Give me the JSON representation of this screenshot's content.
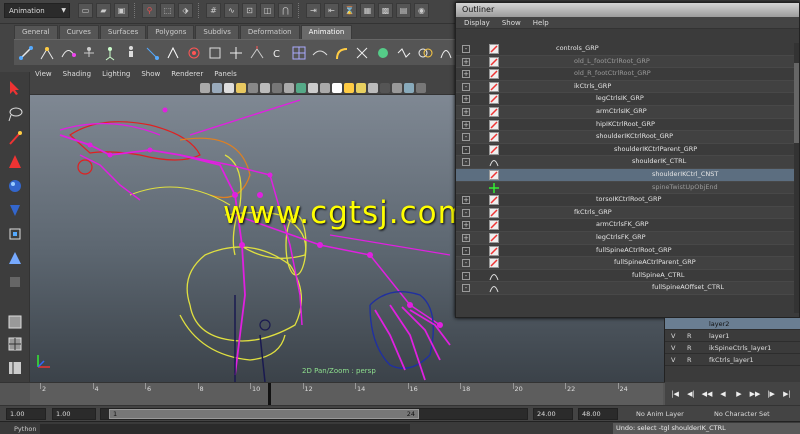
{
  "toolbar": {
    "mode": "Animation",
    "shelf_tabs": [
      "General",
      "Curves",
      "Surfaces",
      "Polygons",
      "Subdivs",
      "Deformation",
      "Animation"
    ],
    "active_tab": "Animation"
  },
  "viewport": {
    "menus": [
      "View",
      "Shading",
      "Lighting",
      "Show",
      "Renderer",
      "Panels"
    ],
    "status": "2D Pan/Zoom : persp",
    "watermark": "www.cgtsj.com"
  },
  "outliner": {
    "title": "Outliner",
    "menus": [
      "Display",
      "Show",
      "Help"
    ],
    "rows": [
      {
        "name": "controls_GRP",
        "depth": 0,
        "icon": "group-icon",
        "expand": "-"
      },
      {
        "name": "old_L_footCtrlRoot_GRP",
        "depth": 1,
        "icon": "group-icon",
        "expand": "+",
        "grey": true
      },
      {
        "name": "old_R_footCtrlRoot_GRP",
        "depth": 1,
        "icon": "group-icon",
        "expand": "+",
        "grey": true
      },
      {
        "name": "ikCtrls_GRP",
        "depth": 1,
        "icon": "group-icon",
        "expand": "-"
      },
      {
        "name": "legCtrlsIK_GRP",
        "depth": 2,
        "icon": "group-icon",
        "expand": "+"
      },
      {
        "name": "armCtrlsIK_GRP",
        "depth": 2,
        "icon": "group-icon",
        "expand": "+"
      },
      {
        "name": "hipIKCtrlRoot_GRP",
        "depth": 2,
        "icon": "group-icon",
        "expand": "+"
      },
      {
        "name": "shoulderIKCtrlRoot_GRP",
        "depth": 2,
        "icon": "group-icon",
        "expand": "-"
      },
      {
        "name": "shoulderIKCtrlParent_GRP",
        "depth": 3,
        "icon": "group-icon",
        "expand": "-"
      },
      {
        "name": "shoulderIK_CTRL",
        "depth": 4,
        "icon": "curve-icon",
        "expand": "-"
      },
      {
        "name": "shoulderIKCtrl_CNST",
        "depth": 5,
        "icon": "group-icon",
        "expand": "",
        "selected": true
      },
      {
        "name": "spineTwistUpObjEnd",
        "depth": 5,
        "icon": "locator-icon",
        "expand": "",
        "grey": true
      },
      {
        "name": "torsoIKCtrlRoot_GRP",
        "depth": 2,
        "icon": "group-icon",
        "expand": "+"
      },
      {
        "name": "fkCtrls_GRP",
        "depth": 1,
        "icon": "group-icon",
        "expand": "-"
      },
      {
        "name": "armCtrlsFK_GRP",
        "depth": 2,
        "icon": "group-icon",
        "expand": "+"
      },
      {
        "name": "legCtrlsFK_GRP",
        "depth": 2,
        "icon": "group-icon",
        "expand": "+"
      },
      {
        "name": "fullSpineACtrlRoot_GRP",
        "depth": 2,
        "icon": "group-icon",
        "expand": "-"
      },
      {
        "name": "fullSpineACtrlParent_GRP",
        "depth": 3,
        "icon": "group-icon",
        "expand": "-"
      },
      {
        "name": "fullSpineA_CTRL",
        "depth": 4,
        "icon": "curve-icon",
        "expand": "-"
      },
      {
        "name": "fullSpineAOffset_CTRL",
        "depth": 5,
        "icon": "curve-icon",
        "expand": "-"
      }
    ]
  },
  "layers": {
    "rows": [
      {
        "v": "",
        "r": "",
        "name": "layer2",
        "highlight": true
      },
      {
        "v": "V",
        "r": "R",
        "name": "layer1"
      },
      {
        "v": "V",
        "r": "R",
        "name": "ikSpineCtrls_layer1"
      },
      {
        "v": "V",
        "r": "R",
        "name": "fkCtrls_layer1"
      }
    ]
  },
  "timeline": {
    "ticks": [
      "2",
      "4",
      "6",
      "8",
      "10",
      "12",
      "14",
      "16",
      "18",
      "20",
      "22",
      "24"
    ],
    "current_frame": "10"
  },
  "range": {
    "start_time": "1.00",
    "start_range": "1.00",
    "handle_left": "1",
    "handle_right": "24",
    "end_range": "24.00",
    "end_time": "48.00",
    "anim_layer": "No Anim Layer",
    "character_set": "No Character Set"
  },
  "command": {
    "label": "Python",
    "result": "Undo: select -tgl shoulderIK_CTRL"
  },
  "colors": {
    "rig_magenta": "#e020e0",
    "rig_yellow": "#e0e040",
    "rig_red": "#e02020",
    "rig_blue": "#2030a0",
    "selected_row": "#5c6e80"
  }
}
